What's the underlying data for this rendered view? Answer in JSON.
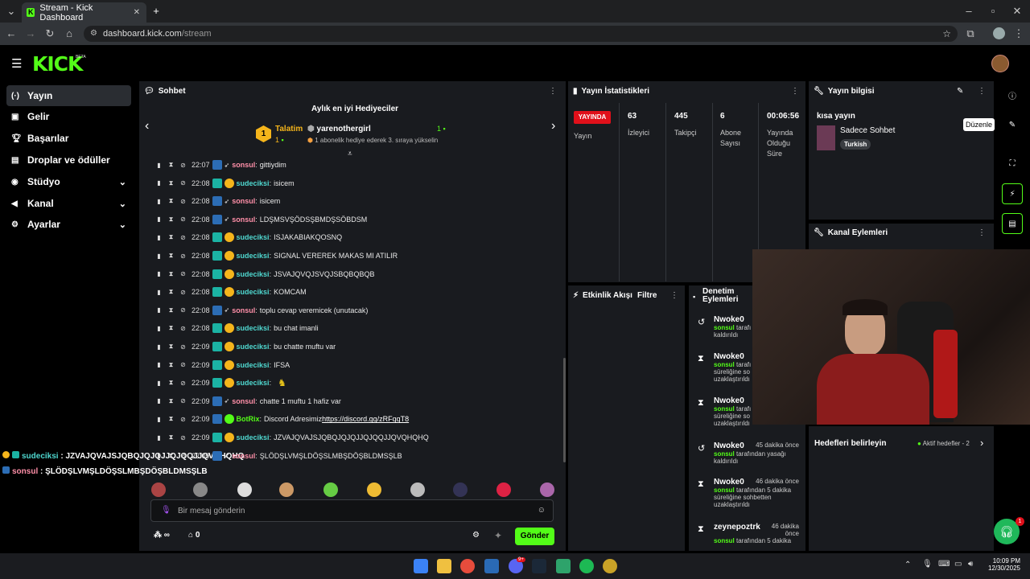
{
  "browser": {
    "tab_title": "Stream - Kick Dashboard",
    "url_host": "dashboard.kick.com",
    "url_path": "/stream",
    "new_tab": "+"
  },
  "kick": {
    "logo": "KICK",
    "beta": "BETA"
  },
  "sidebar": {
    "items": [
      {
        "label": "Yayın",
        "icon": "broadcast-icon",
        "active": true
      },
      {
        "label": "Gelir",
        "icon": "money-icon"
      },
      {
        "label": "Başarılar",
        "icon": "trophy-icon"
      },
      {
        "label": "Droplar ve ödüller",
        "icon": "gift-icon"
      },
      {
        "label": "Stüdyo",
        "icon": "studio-icon",
        "chevron": true
      },
      {
        "label": "Kanal",
        "icon": "megaphone-icon",
        "chevron": true
      },
      {
        "label": "Ayarlar",
        "icon": "gear-icon",
        "chevron": true
      }
    ]
  },
  "chat": {
    "title": "Sohbet",
    "gifters_title": "Aylık en iyi Hediyeciler",
    "gifter1": {
      "name": "Talatim",
      "count": "1",
      "rank": "1"
    },
    "gifter2": {
      "name": "yarenothergirl",
      "count": "1",
      "note": "1 abonelik hediye ederek 3. sıraya yükselin"
    },
    "messages": [
      {
        "time": "22:07",
        "user": "sonsul",
        "text": "gittiydim",
        "type": "pink"
      },
      {
        "time": "22:08",
        "user": "sudeciksi",
        "text": "isicem",
        "type": "teal"
      },
      {
        "time": "22:08",
        "user": "sonsul",
        "text": "isicem",
        "type": "pink"
      },
      {
        "time": "22:08",
        "user": "sonsul",
        "text": "LDŞMSVŞÖDSŞBMDŞSÖBDSM",
        "type": "pink"
      },
      {
        "time": "22:08",
        "user": "sudeciksi",
        "text": "ISJAKABIAKQOSNQ",
        "type": "teal"
      },
      {
        "time": "22:08",
        "user": "sudeciksi",
        "text": "SIGNAL VEREREK MAKAS MI ATILIR",
        "type": "teal"
      },
      {
        "time": "22:08",
        "user": "sudeciksi",
        "text": "JSVAJQVQJSVQJSBQBQBQB",
        "type": "teal"
      },
      {
        "time": "22:08",
        "user": "sudeciksi",
        "text": "KOMCAM",
        "type": "teal"
      },
      {
        "time": "22:08",
        "user": "sonsul",
        "text": "toplu cevap veremicek (unutacak)",
        "type": "pink"
      },
      {
        "time": "22:08",
        "user": "sudeciksi",
        "text": "bu chat imanli",
        "type": "teal"
      },
      {
        "time": "22:09",
        "user": "sudeciksi",
        "text": "bu chatte muftu var",
        "type": "teal"
      },
      {
        "time": "22:09",
        "user": "sudeciksi",
        "text": "IFSA",
        "type": "teal"
      },
      {
        "time": "22:09",
        "user": "sudeciksi",
        "text": "",
        "type": "teal"
      },
      {
        "time": "22:09",
        "user": "sonsul",
        "text": "chatte 1 muftu 1 hafiz var",
        "type": "pink"
      },
      {
        "time": "22:09",
        "user": "BotRix",
        "text": "Discord Adresimiz ",
        "link": "https://discord.gg/zRFqqT8",
        "type": "bot"
      },
      {
        "time": "22:09",
        "user": "sudeciksi",
        "text": "JZVAJQVAJSJQBQJQJQJJQJQQJJQVQHQHQ",
        "type": "teal"
      },
      {
        "time": "22:09",
        "user": "sonsul",
        "text": "ŞLÖDŞLVMŞLDÖŞSLMBŞDÖŞBLDMSŞLB",
        "type": "pink"
      }
    ],
    "overlay": [
      {
        "user": "sudeciksi",
        "text": ": JZVAJQVAJSJQBQJQJQJJQJQQJJQVQHQHQ"
      },
      {
        "user": "sonsul",
        "text": ": ŞLÖDŞLVMŞLDÖŞSLMBŞDÖŞBLDMSŞLB"
      }
    ],
    "input_placeholder": "Bir mesaj gönderin",
    "send": "Gönder",
    "loop_count": "∞",
    "store_count": "0"
  },
  "stats": {
    "title": "Yayın İstatistikleri",
    "live_badge": "YAYINDA",
    "live_label": "Yayın",
    "viewers": {
      "value": "63",
      "label": "İzleyici"
    },
    "followers": {
      "value": "445",
      "label": "Takipçi"
    },
    "subs": {
      "value": "6",
      "label1": "Abone",
      "label2": "Sayısı"
    },
    "uptime": {
      "value": "00:06:56",
      "label1": "Yayında",
      "label2": "Olduğu",
      "label3": "Süre"
    }
  },
  "info": {
    "title": "Yayın bilgisi",
    "stream_title": "kısa yayın",
    "category": "Sadece Sohbet",
    "tag": "Turkish",
    "tooltip": "Düzenle"
  },
  "actions": {
    "title": "Kanal Eylemleri"
  },
  "activity": {
    "title": "Etkinlik Akışı",
    "filter": "Filtre"
  },
  "moderation": {
    "title1": "Denetim",
    "title2": "Eylemleri",
    "items": [
      {
        "name": "Nwoke0",
        "l1_user": "sonsul",
        "l1": " tarafı",
        "l2": "kaldırıldı",
        "icon": "undo-icon"
      },
      {
        "name": "Nwoke0",
        "l1_user": "sonsul",
        "l1": " tarafı",
        "l2": "süreliğine so",
        "l3": "uzaklaştırıldı",
        "icon": "hourglass-icon"
      },
      {
        "name": "Nwoke0",
        "l1_user": "sonsul",
        "l1": " tarafı",
        "l2": "süreliğine so",
        "l3": "uzaklaştırıldı",
        "icon": "hourglass-icon"
      },
      {
        "name": "Nwoke0",
        "time": "45 dakika önce",
        "l1_user": "sonsul",
        "l1": " tarafından yasağı",
        "l2": "kaldırıldı",
        "icon": "undo-icon"
      },
      {
        "name": "Nwoke0",
        "time": "46 dakika önce",
        "l1_user": "sonsul",
        "l1": " tarafından 5 dakika",
        "l2": "süreliğine sohbetten",
        "l3": "uzaklaştırıldı",
        "icon": "hourglass-icon"
      },
      {
        "name": "zeynepoztrk",
        "time1": "46 dakika",
        "time2": "önce",
        "l1_user": "sonsul",
        "l1": " tarafından 5 dakika",
        "icon": "hourglass-icon"
      }
    ]
  },
  "goals": {
    "title": "Hedefleri belirleyin",
    "active": "Aktif hedefler - 2"
  },
  "support": {
    "badge": "1"
  },
  "taskbar": {
    "time": "10:09 PM",
    "date": "12/30/2025",
    "discord_badge": "9+"
  },
  "colors": {
    "brand": "#53fc18",
    "panel": "#191b1f",
    "live": "#e0101a"
  }
}
